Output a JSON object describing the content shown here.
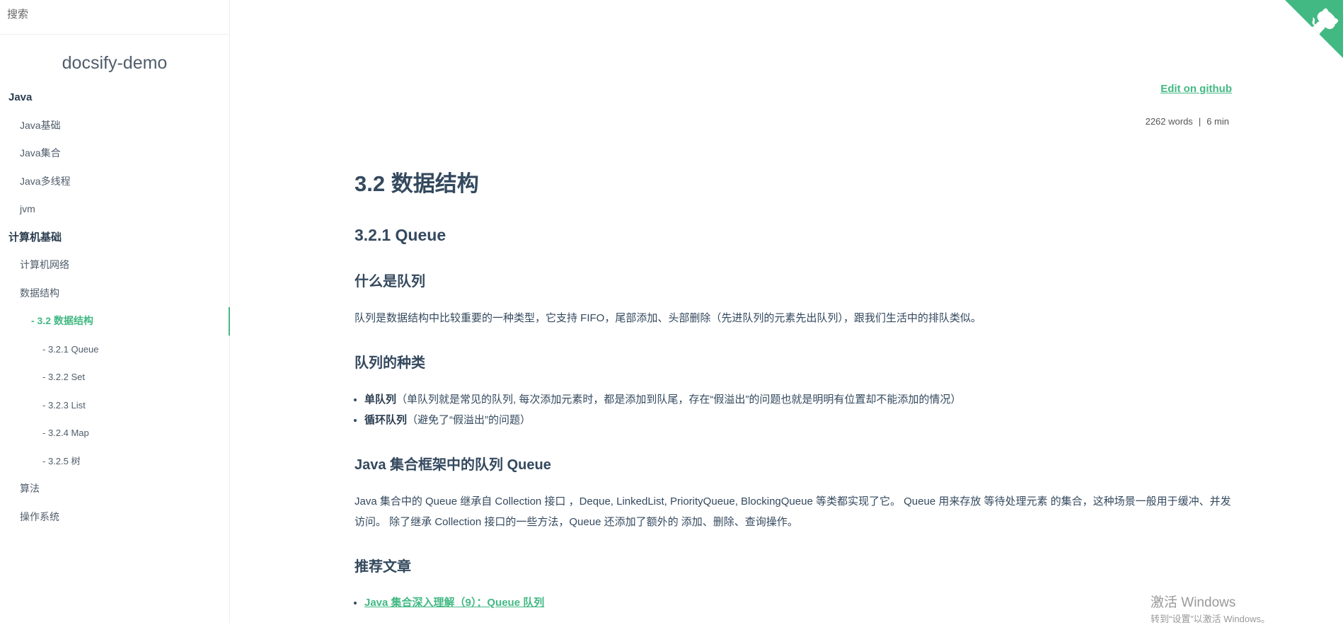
{
  "sidebar": {
    "search_placeholder": "搜索",
    "app_name": "docsify-demo",
    "items": [
      {
        "label": "Java",
        "level": "grp"
      },
      {
        "label": "Java基础",
        "level": "l1"
      },
      {
        "label": "Java集合",
        "level": "l1"
      },
      {
        "label": "Java多线程",
        "level": "l1"
      },
      {
        "label": "jvm",
        "level": "l1"
      },
      {
        "label": "计算机基础",
        "level": "grp"
      },
      {
        "label": "计算机网络",
        "level": "l1"
      },
      {
        "label": "数据结构",
        "level": "l1"
      },
      {
        "label": "- 3.2 数据结构",
        "level": "l2",
        "active": true
      },
      {
        "label": "- 3.2.1 Queue",
        "level": "l3"
      },
      {
        "label": "- 3.2.2 Set",
        "level": "l3"
      },
      {
        "label": "- 3.2.3 List",
        "level": "l3"
      },
      {
        "label": "- 3.2.4 Map",
        "level": "l3"
      },
      {
        "label": "- 3.2.5 树",
        "level": "l3"
      },
      {
        "label": "算法",
        "level": "l1"
      },
      {
        "label": "操作系统",
        "level": "l1"
      }
    ]
  },
  "accent": "#42b983",
  "main": {
    "edit_link": "Edit on github",
    "word_count": "2262 words",
    "separator": "|",
    "read_time": "6 min",
    "h1": "3.2 数据结构",
    "h2": "3.2.1 Queue",
    "h3_what": "什么是队列",
    "p_what": "队列是数据结构中比较重要的一种类型，它支持 FIFO，尾部添加、头部删除（先进队列的元素先出队列），跟我们生活中的排队类似。",
    "h3_kinds": "队列的种类",
    "kinds": [
      {
        "bold": "单队列",
        "text": "（单队列就是常见的队列, 每次添加元素时，都是添加到队尾，存在“假溢出”的问题也就是明明有位置却不能添加的情况）"
      },
      {
        "bold": "循环队列",
        "text": "（避免了“假溢出”的问题）"
      }
    ],
    "h3_java": "Java 集合框架中的队列 Queue",
    "p_java": "Java 集合中的 Queue 继承自 Collection 接口 ，Deque, LinkedList, PriorityQueue, BlockingQueue 等类都实现了它。 Queue 用来存放 等待处理元素 的集合，这种场景一般用于缓冲、并发访问。 除了继承 Collection 接口的一些方法，Queue 还添加了额外的 添加、删除、查询操作。",
    "h3_rec": "推荐文章",
    "rec_link": "Java 集合深入理解（9）：Queue 队列"
  },
  "watermark": {
    "line1": "激活 Windows",
    "line2": "转到“设置”以激活 Windows。"
  }
}
